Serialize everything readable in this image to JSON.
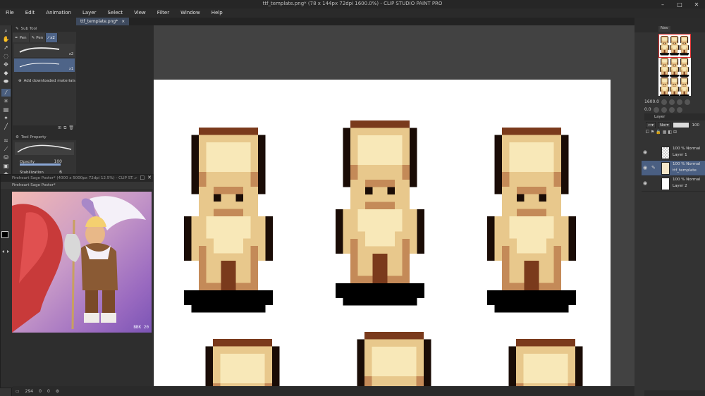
{
  "window": {
    "title": "ttf_template.png* (78 x 144px 72dpi 1600.0%) - CLIP STUDIO PAINT PRO",
    "controls": [
      "minimize-icon",
      "maximize-icon",
      "close-icon"
    ]
  },
  "menu": [
    "File",
    "Edit",
    "Animation",
    "Layer",
    "Select",
    "View",
    "Filter",
    "Window",
    "Help"
  ],
  "canvas_tab": {
    "label": "ttf_template.png*",
    "close": "×"
  },
  "subtool": {
    "title": "Sub Tool",
    "tabs": [
      "Pen",
      "Pen",
      "x2"
    ],
    "brushes": [
      {
        "size": "x2"
      },
      {
        "size": "x1"
      }
    ],
    "add_materials": "Add downloaded materials"
  },
  "tool_property": {
    "title": "Tool Property",
    "opacity_label": "Opacity",
    "opacity_value": "100",
    "stabilization_label": "Stabilization",
    "stabilization_value": "6"
  },
  "reference_window": {
    "title": "Fireheart Sage Poster* (4000 x 5000px 72dpi 12.5%) - CLIP ST...",
    "tab": "Fireheart Sage Poster*",
    "signature": "BBK 20"
  },
  "statusbar": {
    "zoom": "294",
    "angle": "0",
    "rotate": "0"
  },
  "navigator": {
    "tab": "Nav",
    "zoom": "1600.0",
    "rotation": "0.0"
  },
  "layer_panel": {
    "tab": "Layer",
    "blend_mode": "Nor",
    "opacity": "100",
    "layers": [
      {
        "mode": "100 % Normal",
        "name": "Layer 1",
        "selected": false
      },
      {
        "mode": "100 % Normal",
        "name": "ttf_template",
        "selected": true
      },
      {
        "mode": "100 % Normal",
        "name": "Layer 2",
        "selected": false
      }
    ]
  },
  "colors": {
    "accent": "#4e6488",
    "panel": "#333333",
    "canvas_bg": "#424242",
    "skin_light": "#f8e8b8",
    "skin_mid": "#e8c88c",
    "skin_dark": "#c48a58",
    "outline_brown": "#7a3a1c"
  }
}
